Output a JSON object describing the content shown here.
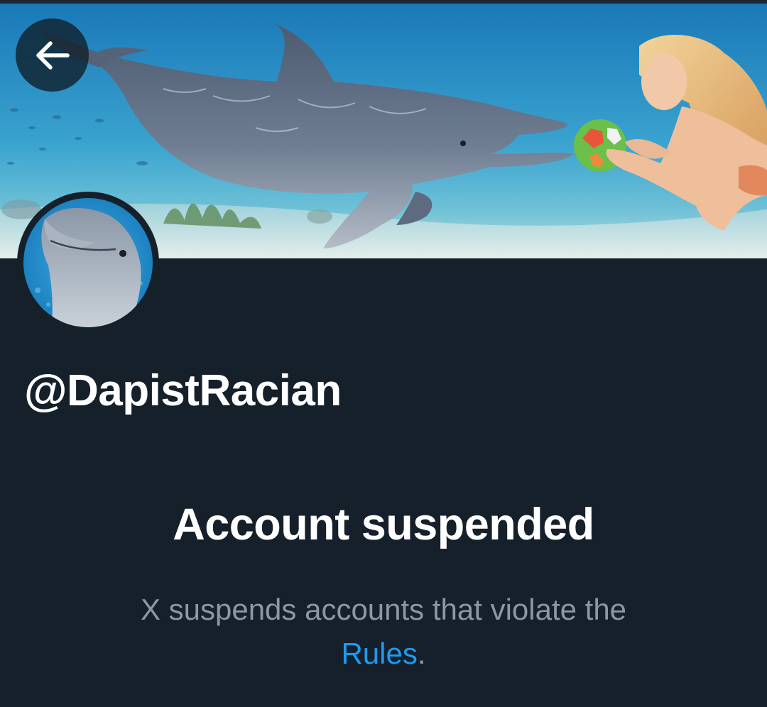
{
  "header": {
    "back_icon": "arrow-left-icon",
    "banner_image": "dolphin-and-swimmer-underwater"
  },
  "profile": {
    "avatar_image": "dolphin-portrait",
    "handle": "@DapistRacian"
  },
  "suspension": {
    "title": "Account suspended",
    "message_prefix": "X suspends accounts that violate the",
    "link_text": "Rules",
    "message_suffix": "."
  },
  "colors": {
    "background": "#15202b",
    "text_primary": "#ffffff",
    "text_secondary": "#8b98a5",
    "link": "#1d9bf0"
  }
}
